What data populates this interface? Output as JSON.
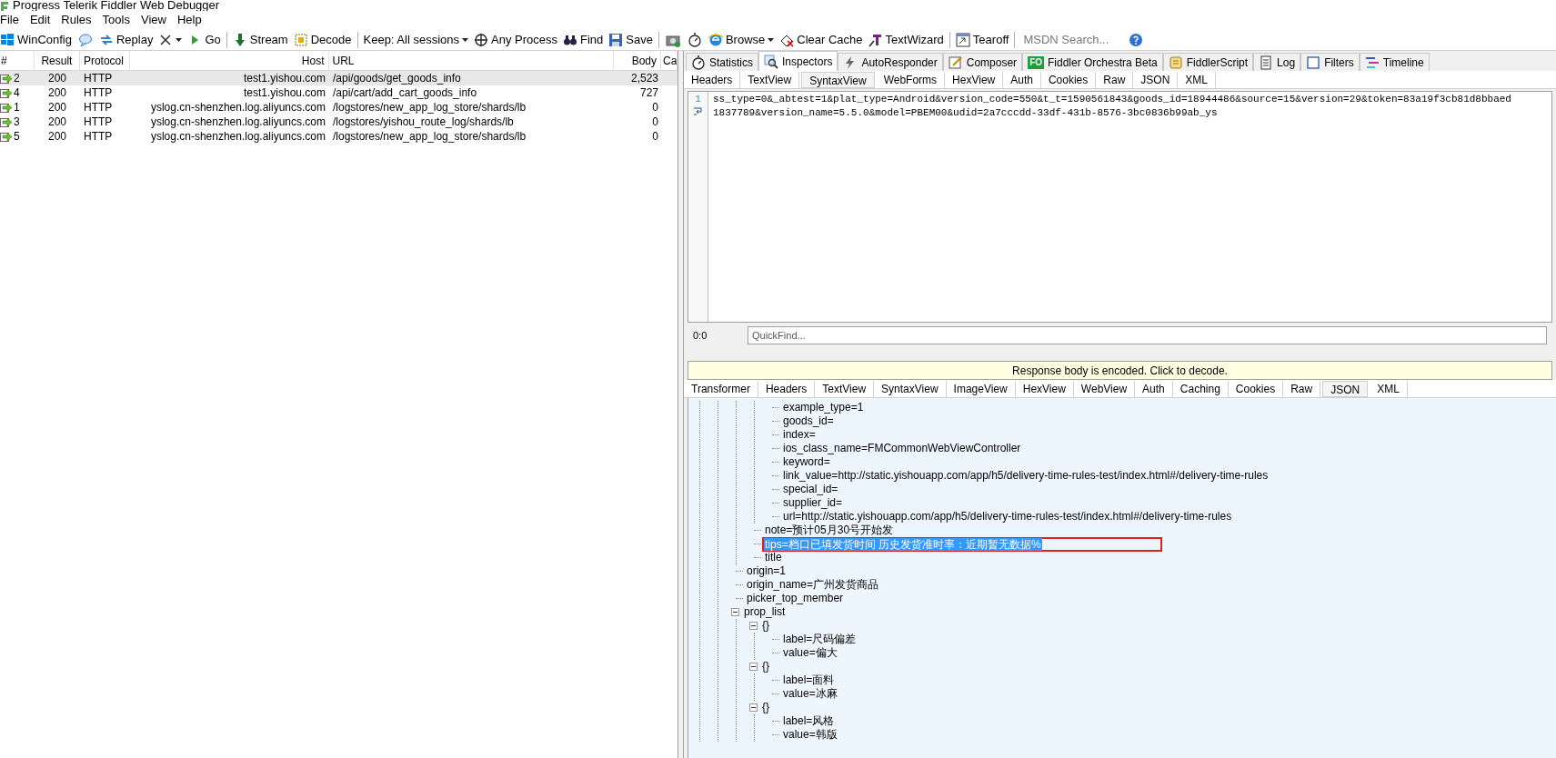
{
  "window": {
    "title": "Progress Telerik Fiddler Web Debugger"
  },
  "menu": [
    "File",
    "Edit",
    "Rules",
    "Tools",
    "View",
    "Help"
  ],
  "toolbar": [
    {
      "kind": "button",
      "label": "WinConfig"
    },
    {
      "kind": "icon"
    },
    {
      "kind": "button",
      "label": "Replay"
    },
    {
      "kind": "dropdown"
    },
    {
      "kind": "button",
      "label": "Go"
    },
    {
      "kind": "separator"
    },
    {
      "kind": "button",
      "label": "Stream"
    },
    {
      "kind": "button",
      "label": "Decode"
    },
    {
      "kind": "separator"
    },
    {
      "kind": "dropdown",
      "label": "Keep: All sessions"
    },
    {
      "kind": "button",
      "label": "Any Process"
    },
    {
      "kind": "button",
      "label": "Find"
    },
    {
      "kind": "button",
      "label": "Save"
    },
    {
      "kind": "separator"
    },
    {
      "kind": "icon"
    },
    {
      "kind": "icon"
    },
    {
      "kind": "dropdown",
      "label": "Browse"
    },
    {
      "kind": "button",
      "label": "Clear Cache"
    },
    {
      "kind": "button",
      "label": "TextWizard"
    },
    {
      "kind": "separator"
    },
    {
      "kind": "button",
      "label": "Tearoff"
    },
    {
      "kind": "separator"
    },
    {
      "kind": "search",
      "placeholder": "MSDN Search..."
    },
    {
      "kind": "icon"
    }
  ],
  "sessions": {
    "columns": [
      "#",
      "Result",
      "Protocol",
      "Host",
      "URL",
      "Body",
      "Ca"
    ],
    "rows": [
      {
        "id": "2",
        "result": "200",
        "protocol": "HTTP",
        "host": "test1.yishou.com",
        "url": "/api/goods/get_goods_info",
        "body": "2,523",
        "selected": true
      },
      {
        "id": "4",
        "result": "200",
        "protocol": "HTTP",
        "host": "test1.yishou.com",
        "url": "/api/cart/add_cart_goods_info",
        "body": "727",
        "selected": false
      },
      {
        "id": "1",
        "result": "200",
        "protocol": "HTTP",
        "host": "yslog.cn-shenzhen.log.aliyuncs.com",
        "url": "/logstores/new_app_log_store/shards/lb",
        "body": "0",
        "selected": false
      },
      {
        "id": "3",
        "result": "200",
        "protocol": "HTTP",
        "host": "yslog.cn-shenzhen.log.aliyuncs.com",
        "url": "/logstores/yishou_route_log/shards/lb",
        "body": "0",
        "selected": false
      },
      {
        "id": "5",
        "result": "200",
        "protocol": "HTTP",
        "host": "yslog.cn-shenzhen.log.aliyuncs.com",
        "url": "/logstores/new_app_log_store/shards/lb",
        "body": "0",
        "selected": false
      }
    ]
  },
  "main_tabs": [
    {
      "label": "Statistics",
      "selected": false
    },
    {
      "label": "Inspectors",
      "selected": true
    },
    {
      "label": "AutoResponder",
      "selected": false
    },
    {
      "label": "Composer",
      "selected": false
    },
    {
      "label": "Fiddler Orchestra Beta",
      "selected": false
    },
    {
      "label": "FiddlerScript",
      "selected": false
    },
    {
      "label": "Log",
      "selected": false
    },
    {
      "label": "Filters",
      "selected": false
    },
    {
      "label": "Timeline",
      "selected": false
    }
  ],
  "orchestra_badge": "FO",
  "request": {
    "tabs": [
      {
        "label": "Headers",
        "selected": false
      },
      {
        "label": "TextView",
        "selected": false
      },
      {
        "label": "SyntaxView",
        "selected": true
      },
      {
        "label": "WebForms",
        "selected": false
      },
      {
        "label": "HexView",
        "selected": false
      },
      {
        "label": "Auth",
        "selected": false
      },
      {
        "label": "Cookies",
        "selected": false
      },
      {
        "label": "Raw",
        "selected": false
      },
      {
        "label": "JSON",
        "selected": false
      },
      {
        "label": "XML",
        "selected": false
      }
    ],
    "line_number": "1",
    "lines": [
      "ss_type=0&_abtest=1&plat_type=Android&version_code=550&t_t=1590561843&goods_id=18944486&source=15&version=29&token=83a19f3cb81d8bbaed",
      "1837789&version_name=5.5.0&model=PBEM00&udid=2a7cccdd-33df-431b-8576-3bc0836b99ab_ys"
    ],
    "position": "0:0",
    "quickfind_placeholder": "QuickFind..."
  },
  "response": {
    "banner": "Response body is encoded. Click to decode.",
    "tabs": [
      {
        "label": "Transformer",
        "selected": false
      },
      {
        "label": "Headers",
        "selected": false
      },
      {
        "label": "TextView",
        "selected": false
      },
      {
        "label": "SyntaxView",
        "selected": false
      },
      {
        "label": "ImageView",
        "selected": false
      },
      {
        "label": "HexView",
        "selected": false
      },
      {
        "label": "WebView",
        "selected": false
      },
      {
        "label": "Auth",
        "selected": false
      },
      {
        "label": "Caching",
        "selected": false
      },
      {
        "label": "Cookies",
        "selected": false
      },
      {
        "label": "Raw",
        "selected": false
      },
      {
        "label": "JSON",
        "selected": true
      },
      {
        "label": "XML",
        "selected": false
      }
    ],
    "tree": [
      {
        "children": [
          {
            "children": [
              {
                "text": "example_type=1",
                "selected": false
              },
              {
                "text": "goods_id=",
                "selected": false
              },
              {
                "text": "index=",
                "selected": false
              },
              {
                "text": "ios_class_name=FMCommonWebViewController",
                "selected": false
              },
              {
                "text": "keyword=",
                "selected": false
              },
              {
                "text": "link_value=http://static.yishouapp.com/app/h5/delivery-time-rules-test/index.html#/delivery-time-rules",
                "selected": false
              },
              {
                "text": "special_id=",
                "selected": false
              },
              {
                "text": "supplier_id=",
                "selected": false
              },
              {
                "text": "url=http://static.yishouapp.com/app/h5/delivery-time-rules-test/index.html#/delivery-time-rules",
                "selected": false
              }
            ]
          },
          {
            "text": "note=预计05月30号开始发",
            "selected": false
          },
          {
            "text": "tips=档口已填发货时间 历史发货准时率：近期暂无数据%",
            "selected": true,
            "marked": true
          },
          {
            "text": "title",
            "selected": false
          }
        ]
      },
      {
        "text": "origin=1",
        "selected": false
      },
      {
        "text": "origin_name=广州发货商品",
        "selected": false
      },
      {
        "text": "picker_top_member",
        "selected": false
      },
      {
        "text": "prop_list",
        "selected": false,
        "expanded": true,
        "children": [
          {
            "text": "{}",
            "selected": false,
            "expanded": true,
            "children": [
              {
                "text": "label=尺码偏差",
                "selected": false
              },
              {
                "text": "value=偏大",
                "selected": false
              }
            ]
          },
          {
            "text": "{}",
            "selected": false,
            "expanded": true,
            "children": [
              {
                "text": "label=面料",
                "selected": false
              },
              {
                "text": "value=冰麻",
                "selected": false
              }
            ]
          },
          {
            "text": "{}",
            "selected": false,
            "expanded": true,
            "children": [
              {
                "text": "label=风格",
                "selected": false
              },
              {
                "text": "value=韩版",
                "selected": false
              }
            ]
          }
        ]
      }
    ]
  }
}
